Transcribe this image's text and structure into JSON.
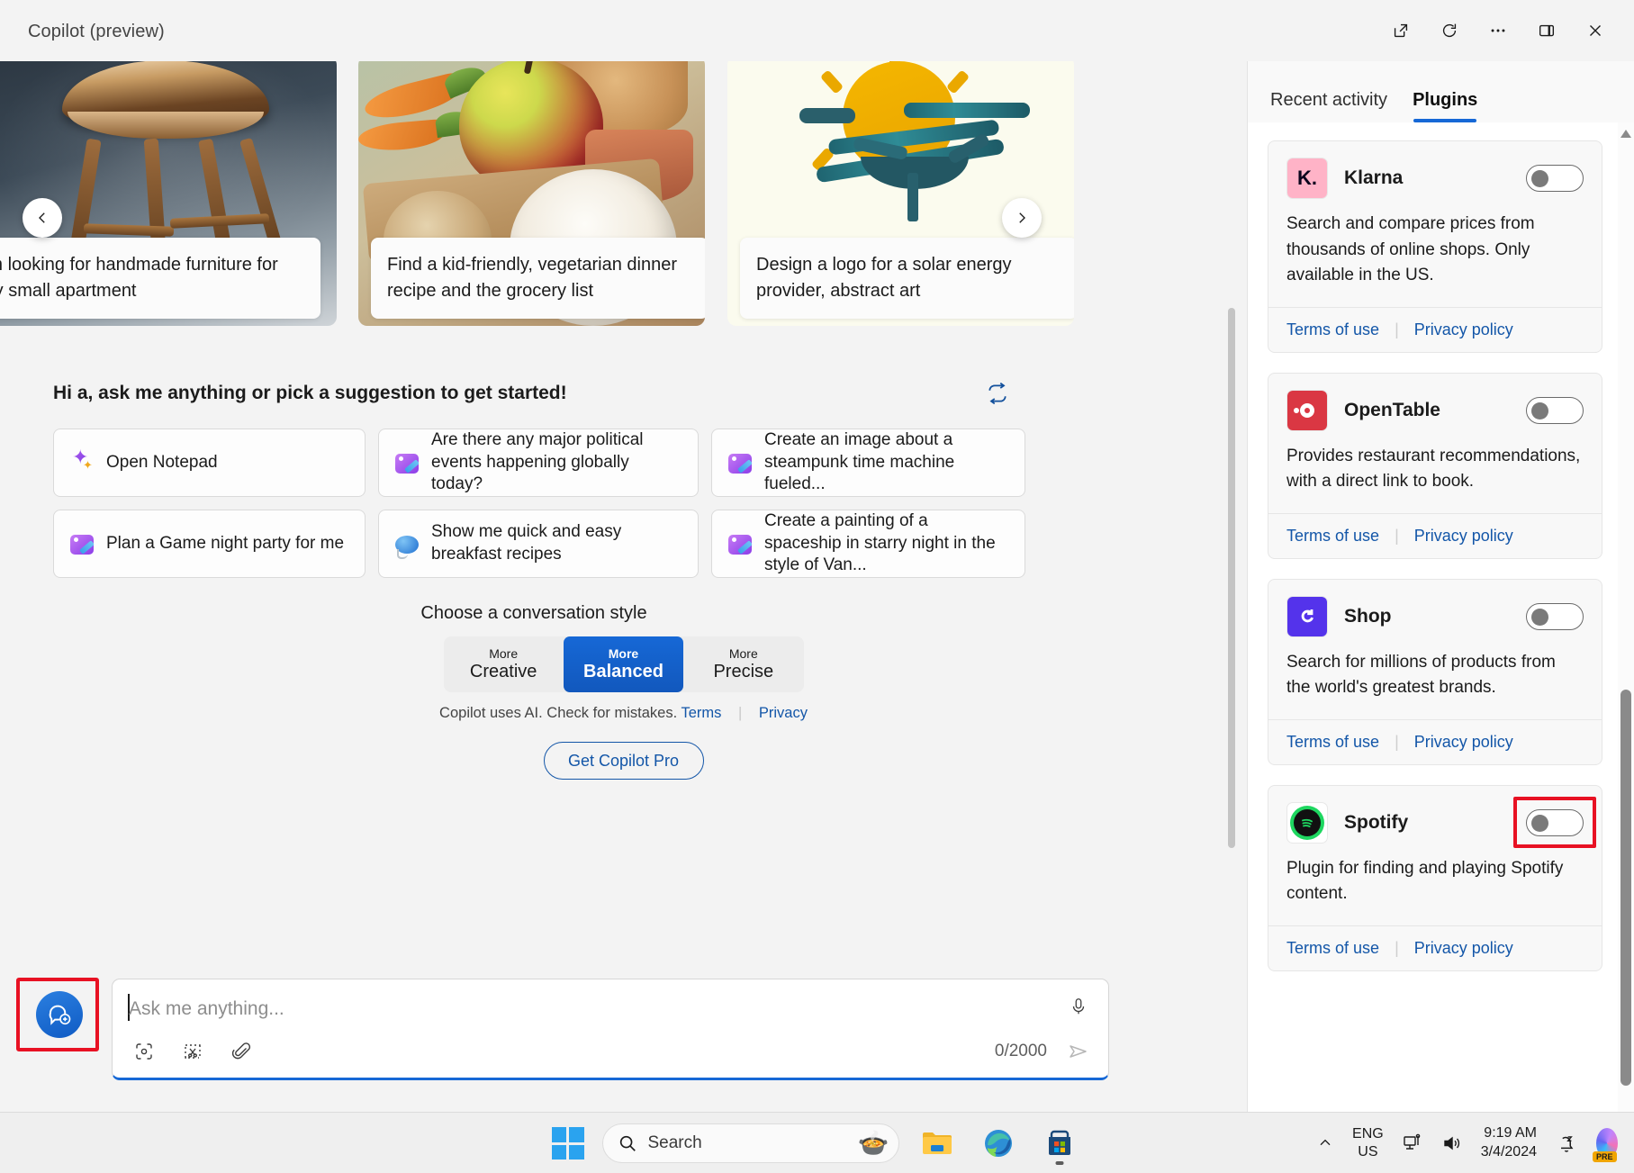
{
  "window": {
    "title": "Copilot (preview)",
    "toolbar": [
      {
        "name": "open-in-new-window-icon",
        "label": "Open in new window"
      },
      {
        "name": "refresh-icon",
        "label": "Refresh"
      },
      {
        "name": "more-options-icon",
        "label": "More options"
      },
      {
        "name": "split-pane-icon",
        "label": "Toggle pane"
      },
      {
        "name": "close-icon",
        "label": "Close"
      }
    ]
  },
  "carousel": {
    "prev_label": "Previous",
    "next_label": "Next",
    "cards": [
      {
        "caption": "I'm looking for handmade furniture for my small apartment",
        "image": "wooden-chair"
      },
      {
        "caption": "Find a kid-friendly, vegetarian dinner recipe and the grocery list",
        "image": "apple-carrots-rice"
      },
      {
        "caption": "Design a logo for a solar energy provider, abstract art",
        "image": "solar-sun-boat-logo"
      }
    ]
  },
  "main": {
    "greeting": "Hi a, ask me anything or pick a suggestion to get started!",
    "refresh_suggestions_label": "Refresh suggestions",
    "suggestions": [
      {
        "text": "Open Notepad",
        "icon": "sparkle-icon"
      },
      {
        "text": "Are there any major political events happening globally today?",
        "icon": "designer-icon"
      },
      {
        "text": "Create an image about a steampunk time machine fueled...",
        "icon": "designer-icon"
      },
      {
        "text": "Plan a Game night party for me",
        "icon": "designer-icon"
      },
      {
        "text": "Show me quick and easy breakfast recipes",
        "icon": "chat-bubble-icon"
      },
      {
        "text": "Create a painting of a spaceship in starry night in the style of Van...",
        "icon": "designer-icon"
      }
    ],
    "style": {
      "label": "Choose a conversation style",
      "options": [
        {
          "top": "More",
          "bottom": "Creative",
          "active": false
        },
        {
          "top": "More",
          "bottom": "Balanced",
          "active": true
        },
        {
          "top": "More",
          "bottom": "Precise",
          "active": false
        }
      ]
    },
    "legal": {
      "disclaimer": "Copilot uses AI. Check for mistakes.",
      "terms": "Terms",
      "privacy": "Privacy"
    },
    "pro_button": "Get Copilot Pro"
  },
  "composer": {
    "new_chat_label": "New topic",
    "placeholder": "Ask me anything...",
    "value": "",
    "char_count": "0/2000",
    "tools": [
      {
        "name": "visual-search-icon",
        "label": "Visual search"
      },
      {
        "name": "screenshot-snip-icon",
        "label": "Add a screenshot"
      },
      {
        "name": "attach-file-icon",
        "label": "Add an attachment"
      }
    ],
    "mic_label": "Use microphone",
    "send_label": "Submit"
  },
  "sidebar": {
    "tabs": [
      {
        "label": "Recent activity",
        "active": false
      },
      {
        "label": "Plugins",
        "active": true
      }
    ],
    "links": {
      "terms": "Terms of use",
      "privacy": "Privacy policy"
    },
    "plugins": [
      {
        "name": "Klarna",
        "description": "Search and compare prices from thousands of online shops. Only available in the US.",
        "enabled": false,
        "logo": "klarna-logo",
        "highlighted": false
      },
      {
        "name": "OpenTable",
        "description": "Provides restaurant recommendations, with a direct link to book.",
        "enabled": false,
        "logo": "opentable-logo",
        "highlighted": false
      },
      {
        "name": "Shop",
        "description": "Search for millions of products from the world's greatest brands.",
        "enabled": false,
        "logo": "shop-logo",
        "highlighted": false
      },
      {
        "name": "Spotify",
        "description": "Plugin for finding and playing Spotify content.",
        "enabled": false,
        "logo": "spotify-logo",
        "highlighted": true
      }
    ]
  },
  "taskbar": {
    "start_label": "Start",
    "search_placeholder": "Search",
    "apps": [
      {
        "name": "file-explorer-icon",
        "label": "File Explorer",
        "running": false
      },
      {
        "name": "microsoft-edge-icon",
        "label": "Microsoft Edge",
        "running": false
      },
      {
        "name": "microsoft-store-icon",
        "label": "Microsoft Store",
        "running": true
      }
    ],
    "tray": {
      "chevron_label": "Show hidden icons",
      "language_top": "ENG",
      "language_bottom": "US",
      "network_label": "Network",
      "volume_label": "Volume",
      "time": "9:19 AM",
      "date": "3/4/2024",
      "notifications_label": "Notifications - do not disturb",
      "copilot_label": "Copilot",
      "copilot_badge": "PRE"
    }
  },
  "colors": {
    "accent": "#1668d6",
    "link": "#1356a8",
    "highlight": "#e81123",
    "bg": "#f3f3f3"
  }
}
